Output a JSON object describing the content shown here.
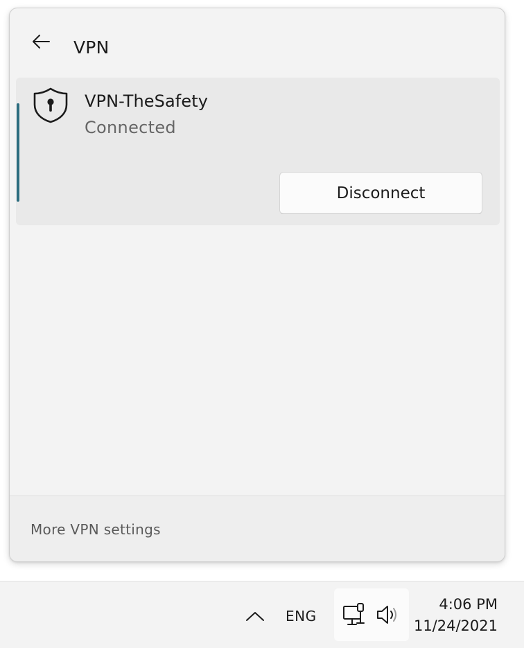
{
  "flyout": {
    "title": "VPN",
    "back_icon": "arrow-left-icon",
    "connection": {
      "icon": "shield-lock-icon",
      "name": "VPN-TheSafety",
      "status": "Connected",
      "disconnect_label": "Disconnect",
      "accent_color": "#2d6e80"
    },
    "footer": {
      "settings_label": "More VPN settings"
    }
  },
  "taskbar": {
    "overflow_icon": "chevron-up-icon",
    "language": "ENG",
    "network_icon": "network-wired-icon",
    "volume_icon": "speaker-icon",
    "time": "4:06 PM",
    "date": "11/24/2021"
  }
}
